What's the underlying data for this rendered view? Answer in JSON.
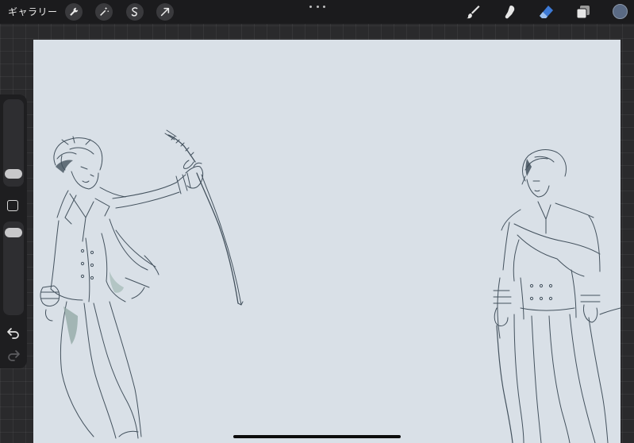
{
  "topbar": {
    "gallery_label": "ギャラリー",
    "left_tools": [
      "wrench-icon",
      "magic-wand-icon",
      "selection-icon",
      "transform-icon"
    ],
    "right_tools": [
      "brush-icon",
      "smudge-icon",
      "eraser-icon",
      "layers-icon"
    ],
    "active_tool": "eraser-icon",
    "active_color": "#5a6a84",
    "accent_color": "#3d7ad6"
  },
  "canvas": {
    "background": "#d9e0e7",
    "sketch_color": "#44525e",
    "shade_color": "#8fa7a3"
  },
  "sidebar": {
    "brush_size_level": 0.35,
    "opacity_level": 0.5,
    "icons": [
      "modify-square-icon",
      "undo-icon",
      "redo-icon"
    ]
  }
}
